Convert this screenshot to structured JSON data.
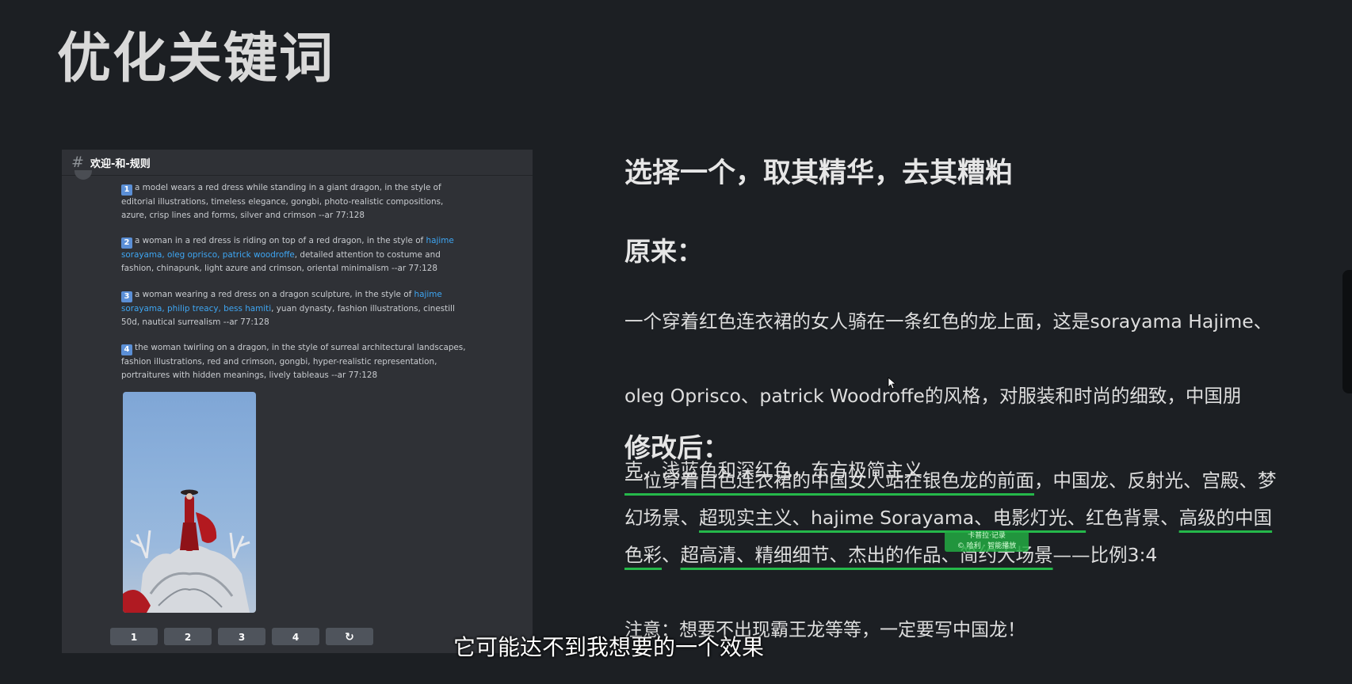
{
  "slide": {
    "title": "优化关键词",
    "subtitle": "选择一个，取其精华，去其糟粕",
    "original_label": "原来：",
    "original_text_lines": [
      "一个穿着红色连衣裙的女人骑在一条红色的龙上面，这是sorayama Hajime、",
      "oleg Oprisco、patrick Woodroffe的风格，对服装和时尚的细致，中国朋",
      "克、浅蓝色和深红色，东方极简主义"
    ],
    "modified_label": "修改后：",
    "modified": {
      "l1_underlined": "一位穿着白色连衣裙的中国女人站在银色龙的前面",
      "l1_rest": "，中国龙、反射光、宫殿、梦",
      "l2_a": "幻场景、",
      "l2_b": "超现实主义、hajime Sorayama、电影灯光、",
      "l2_c": "红色背景、",
      "l2_d": "高级的中国",
      "l3_a": "色彩",
      "l3_b": "、",
      "l3_c": "超高清、精细细节、杰出的作品、简约大场景",
      "l3_d": "——比例3:4"
    },
    "note": "注意：想要不出现霸王龙等等，一定要写中国龙！",
    "caption": "它可能达不到我想要的一个效果"
  },
  "discord": {
    "channel": "欢迎-和-规则",
    "hash_icon": "#",
    "messages": [
      {
        "num": "1",
        "text": "a model wears a red dress while standing in a giant dragon, in the style of editorial illustrations, timeless elegance, gongbi, photo-realistic compositions, azure, crisp lines and forms, silver and crimson --ar 77:128"
      },
      {
        "num": "2",
        "pre": "a woman in a red dress is riding on top of a red dragon, in the style of ",
        "links": "hajime sorayama, oleg oprisco, patrick woodroffe",
        "post": ", detailed attention to costume and fashion, chinapunk, light azure and crimson, oriental minimalism --ar 77:128"
      },
      {
        "num": "3",
        "pre": "a woman wearing a red dress on a dragon sculpture, in the style of ",
        "links": "hajime sorayama, philip treacy, bess hamiti",
        "post": ", yuan dynasty, fashion illustrations, cinestill 50d, nautical surrealism --ar 77:128"
      },
      {
        "num": "4",
        "text": "the woman twirling on a dragon, in the style of surreal architectural landscapes, fashion illustrations, red and crimson, gongbi, hyper-realistic representation, portraitures with hidden meanings, lively tableaus --ar 77:128"
      }
    ],
    "buttons": [
      "1",
      "2",
      "3",
      "4"
    ],
    "refresh_icon": "↻"
  },
  "tooltip": {
    "line1": "卡普拉·记录",
    "line2": "© 哈利 · 智能播放"
  },
  "colors": {
    "background": "#1c1f23",
    "underline": "#25b84a",
    "link": "#3ea6f3",
    "panel": "#2f3136"
  }
}
